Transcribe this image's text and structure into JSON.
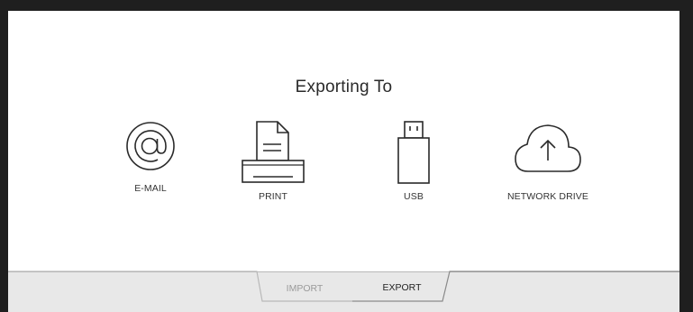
{
  "dialog": {
    "title": "Exporting To"
  },
  "options": [
    {
      "label": "E-MAIL",
      "icon": "at-sign-icon"
    },
    {
      "label": "PRINT",
      "icon": "printer-icon"
    },
    {
      "label": "USB",
      "icon": "usb-drive-icon"
    },
    {
      "label": "NETWORK DRIVE",
      "icon": "cloud-upload-icon"
    }
  ],
  "tabs": [
    {
      "label": "IMPORT",
      "selected": false
    },
    {
      "label": "EXPORT",
      "selected": true
    }
  ],
  "colors": {
    "background": "#1f1f1f",
    "panel": "#ffffff",
    "tab_bar": "#e8e8e8",
    "icon_stroke": "#2a2a2a",
    "inactive_tab_text": "#9a9a9a"
  }
}
